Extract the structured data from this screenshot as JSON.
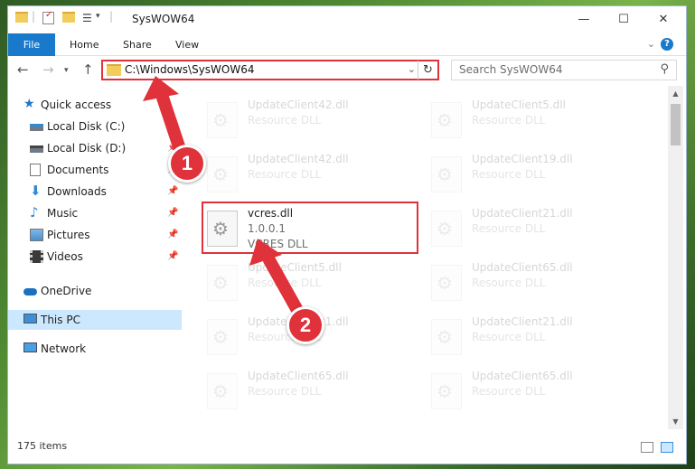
{
  "window": {
    "title": "SysWOW64"
  },
  "ribbon": {
    "tabs": [
      "File",
      "Home",
      "Share",
      "View"
    ],
    "help": "?"
  },
  "nav": {
    "address": "C:\\Windows\\SysWOW64",
    "search_placeholder": "Search SysWOW64"
  },
  "sidebar": {
    "items": [
      {
        "label": "Quick access",
        "icon": "star-icon"
      },
      {
        "label": "Local Disk (C:)",
        "icon": "drive-icon",
        "pinned": true
      },
      {
        "label": "Local Disk (D:)",
        "icon": "drive-icon",
        "pinned": true
      },
      {
        "label": "Documents",
        "icon": "documents-icon",
        "pinned": true
      },
      {
        "label": "Downloads",
        "icon": "downloads-icon",
        "pinned": true
      },
      {
        "label": "Music",
        "icon": "music-icon",
        "pinned": true
      },
      {
        "label": "Pictures",
        "icon": "pictures-icon",
        "pinned": true
      },
      {
        "label": "Videos",
        "icon": "videos-icon",
        "pinned": true
      },
      {
        "label": "OneDrive",
        "icon": "cloud-icon"
      },
      {
        "label": "This PC",
        "icon": "computer-icon",
        "selected": true
      },
      {
        "label": "Network",
        "icon": "network-icon"
      }
    ]
  },
  "files": [
    {
      "name": "UpdateClient42.dll",
      "desc": "Resource DLL"
    },
    {
      "name": "UpdateClient5.dll",
      "desc": "Resource DLL"
    },
    {
      "name": "UpdateClient42.dll",
      "desc": "Resource DLL"
    },
    {
      "name": "UpdateClient19.dll",
      "desc": "Resource DLL"
    },
    {
      "name": "vcres.dll",
      "version": "1.0.0.1",
      "desc": "VCRES DLL"
    },
    {
      "name": "UpdateClient21.dll",
      "desc": "Resource DLL"
    },
    {
      "name": "UpdateClient5.dll",
      "desc": "Resource DLL"
    },
    {
      "name": "UpdateClient65.dll",
      "desc": "Resource DLL"
    },
    {
      "name": "UpdateClient21.dll",
      "desc": "Resource DLL"
    },
    {
      "name": "UpdateClient21.dll",
      "desc": "Resource DLL"
    },
    {
      "name": "UpdateClient65.dll",
      "desc": "Resource DLL"
    },
    {
      "name": "UpdateClient65.dll",
      "desc": "Resource DLL"
    }
  ],
  "status": {
    "count": "175 items"
  },
  "callouts": [
    "1",
    "2"
  ],
  "colors": {
    "accent": "#1979ca",
    "annotation": "#e0323b",
    "selected": "#cce8ff"
  }
}
